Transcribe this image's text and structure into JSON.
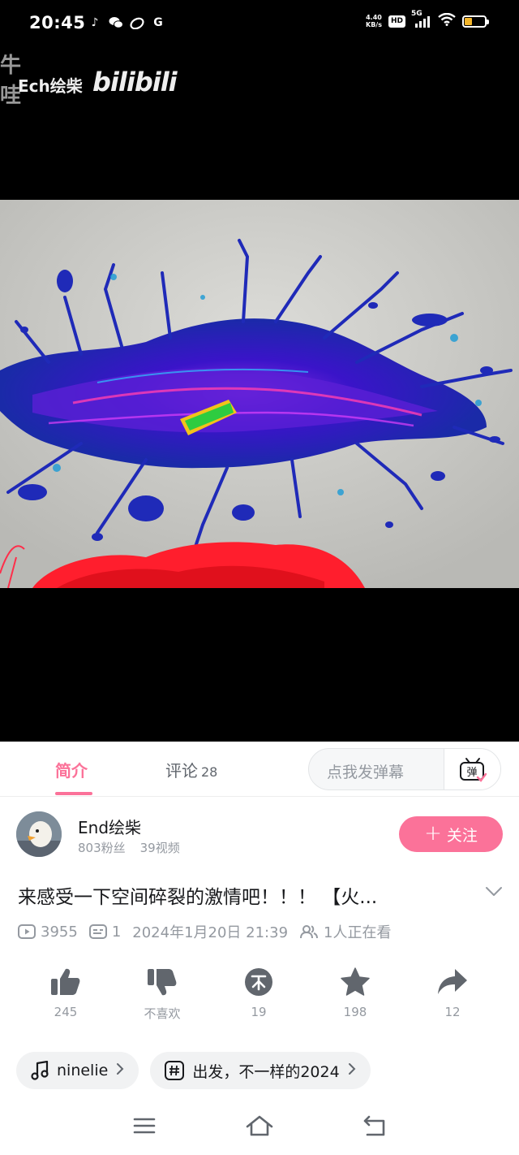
{
  "status_bar": {
    "time": "20:45",
    "app_icons": [
      "tiktok-icon",
      "wechat-icon",
      "weibo-icon",
      "google-icon"
    ],
    "net_speed_value": "4.40",
    "net_speed_unit": "KB/s",
    "hd_label": "HD",
    "signal_label": "5G",
    "battery_level": 0.35,
    "battery_color": "#f5b62b"
  },
  "video": {
    "watermark_top": "牛哇",
    "watermark_author": "Ech绘柴",
    "watermark_logo": "bilibili"
  },
  "tabs": {
    "intro_label": "简介",
    "comments_label": "评论",
    "comments_count": "28",
    "danmaku_placeholder": "点我发弹幕",
    "danmaku_button_label": "弹"
  },
  "uploader": {
    "name": "End绘柴",
    "followers": "803粉丝",
    "videos": "39视频",
    "follow_label": "关注"
  },
  "video_info": {
    "title": "来感受一下空间碎裂的激情吧！！！ 【火...",
    "views": "3955",
    "danmaku_count": "1",
    "publish_time": "2024年1月20日 21:39",
    "watching": "1人正在看"
  },
  "actions": {
    "like_count": "245",
    "dislike_label": "不喜欢",
    "coin_count": "19",
    "favorite_count": "198",
    "share_count": "12"
  },
  "chips": {
    "music_label": "ninelie",
    "topic_label": "出发，不一样的2024"
  },
  "colors": {
    "accent": "#fb7299",
    "text_primary": "#18191c",
    "text_secondary": "#9499a0"
  }
}
